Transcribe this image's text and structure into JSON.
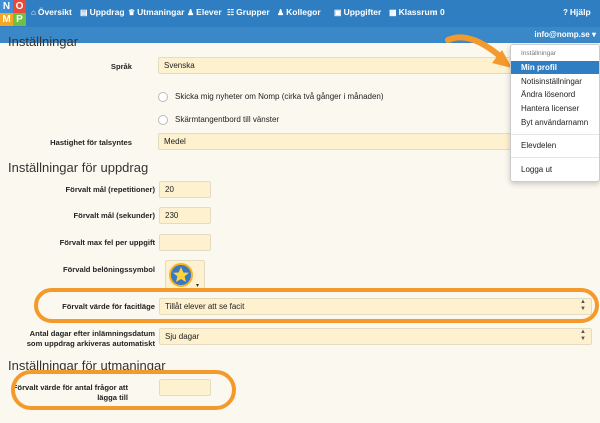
{
  "nav": {
    "logo_letters": [
      "N",
      "O",
      "M",
      "P"
    ],
    "items": [
      {
        "icon": "home-icon",
        "glyph": "⌂",
        "label": "Översikt"
      },
      {
        "icon": "book-icon",
        "glyph": "▤",
        "label": "Uppdrag"
      },
      {
        "icon": "trophy-icon",
        "glyph": "♛",
        "label": "Utmaningar"
      },
      {
        "icon": "person-icon",
        "glyph": "♟",
        "label": "Elever"
      },
      {
        "icon": "group-icon",
        "glyph": "☷",
        "label": "Grupper"
      },
      {
        "icon": "colleagues-icon",
        "glyph": "♟",
        "label": "Kollegor"
      },
      {
        "icon": "tasks-icon",
        "glyph": "▣",
        "label": "Uppgifter"
      },
      {
        "icon": "classroom-icon",
        "glyph": "▦",
        "label": "Klassrum"
      },
      {
        "icon": "bell-icon",
        "glyph": "♫",
        "label": "0"
      }
    ],
    "help": {
      "icon": "help-icon",
      "glyph": "?",
      "label": "Hjälp"
    },
    "user_email": "info@nomp.se"
  },
  "dropdown": {
    "header": "Inställningar",
    "items": [
      "Min profil",
      "Notisinställningar",
      "Ändra lösenord",
      "Hantera licenser",
      "Byt användarnamn"
    ],
    "group2": "Elevdelen",
    "logout": "Logga ut"
  },
  "settings": {
    "section_title": "Inställningar",
    "language_label": "Språk",
    "language_value": "Svenska",
    "newsletter_label": "Skicka mig nyheter om Nomp (cirka två gånger i månaden)",
    "keyboard_label": "Skärmtangentbord till vänster",
    "speech_speed_label": "Hastighet för talsyntes",
    "speech_speed_value": "Medel"
  },
  "assignment": {
    "section_title": "Inställningar för uppdrag",
    "goal_reps_label": "Förvalt mål (repetitioner)",
    "goal_reps_value": "20",
    "goal_secs_label": "Förvalt mål (sekunder)",
    "goal_secs_value": "230",
    "max_errors_label": "Förvalt max fel per uppgift",
    "max_errors_value": "",
    "reward_label": "Förvald belöningssymbol",
    "reward_icon": "star-badge-icon",
    "facit_label": "Förvalt värde för facitläge",
    "facit_value": "Tillåt elever att se facit",
    "archive_label_1": "Antal dagar efter inlämningsdatum",
    "archive_label_2": "som uppdrag arkiveras automatiskt",
    "archive_value": "Sju dagar"
  },
  "challenge": {
    "section_title": "Inställningar för utmaningar",
    "questions_label_1": "Förvalt värde för antal frågor att",
    "questions_label_2": "lägga till",
    "questions_value": ""
  },
  "colors": {
    "nav": "#2f7ec1",
    "accent": "#f49a2c",
    "field": "#fdf1cf"
  }
}
